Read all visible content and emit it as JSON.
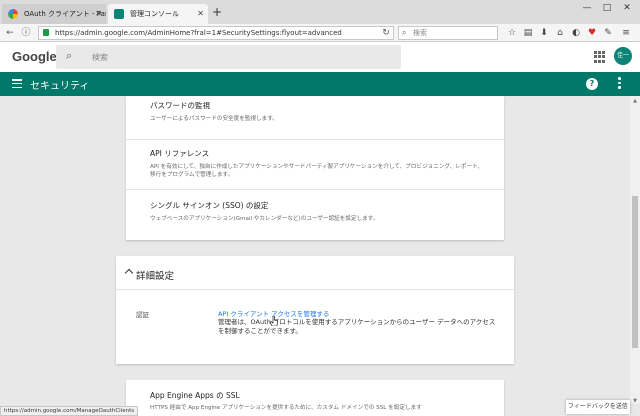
{
  "browser": {
    "tabs": [
      {
        "title": "OAuth クライアント - Passwo…",
        "active": false
      },
      {
        "title": "管理コンソール",
        "active": true
      }
    ],
    "url": "https://admin.google.com/AdminHome?fral=1#SecuritySettings:flyout=advanced",
    "search_placeholder": "検索",
    "window_controls": [
      "—",
      "□",
      "✕"
    ]
  },
  "header": {
    "logo": "Google",
    "search_placeholder": "検索",
    "avatar_text": "佳一"
  },
  "appbar": {
    "title": "セキュリティ"
  },
  "settings_rows": [
    {
      "title": "パスワードの監視",
      "desc": "ユーザーによるパスワードの安全度を監視します。"
    },
    {
      "title": "API リファレンス",
      "desc": "API を有効にして、独自に作成したアプリケーションやサードパーティ製アプリケーションを介して、プロビジョニング、レポート、移行をプログラムで管理します。"
    },
    {
      "title": "シングル サインオン (SSO) の設定",
      "desc": "ウェブベースのアプリケーション(Gmail やカレンダーなど)のユーザー認証を設定します。"
    }
  ],
  "advanced": {
    "title": "詳細設定",
    "auth_label": "認証",
    "link": "API クライアント アクセスを管理する",
    "desc": "管理者は、OAuth プロトコルを使用するアプリケーションからのユーザー データへのアクセスを制御することができます。"
  },
  "next_section": {
    "title": "App Engine Apps の SSL",
    "desc": "HTTPS 経由で App Engine アプリケーションを提供するために、カスタム ドメインでの SSL を設定します"
  },
  "status_url": "https://admin.google.com/ManageOauthClients",
  "feedback_label": "フィードバックを送信",
  "colors": {
    "appbar": "#00796b",
    "link": "#1a73e8"
  }
}
